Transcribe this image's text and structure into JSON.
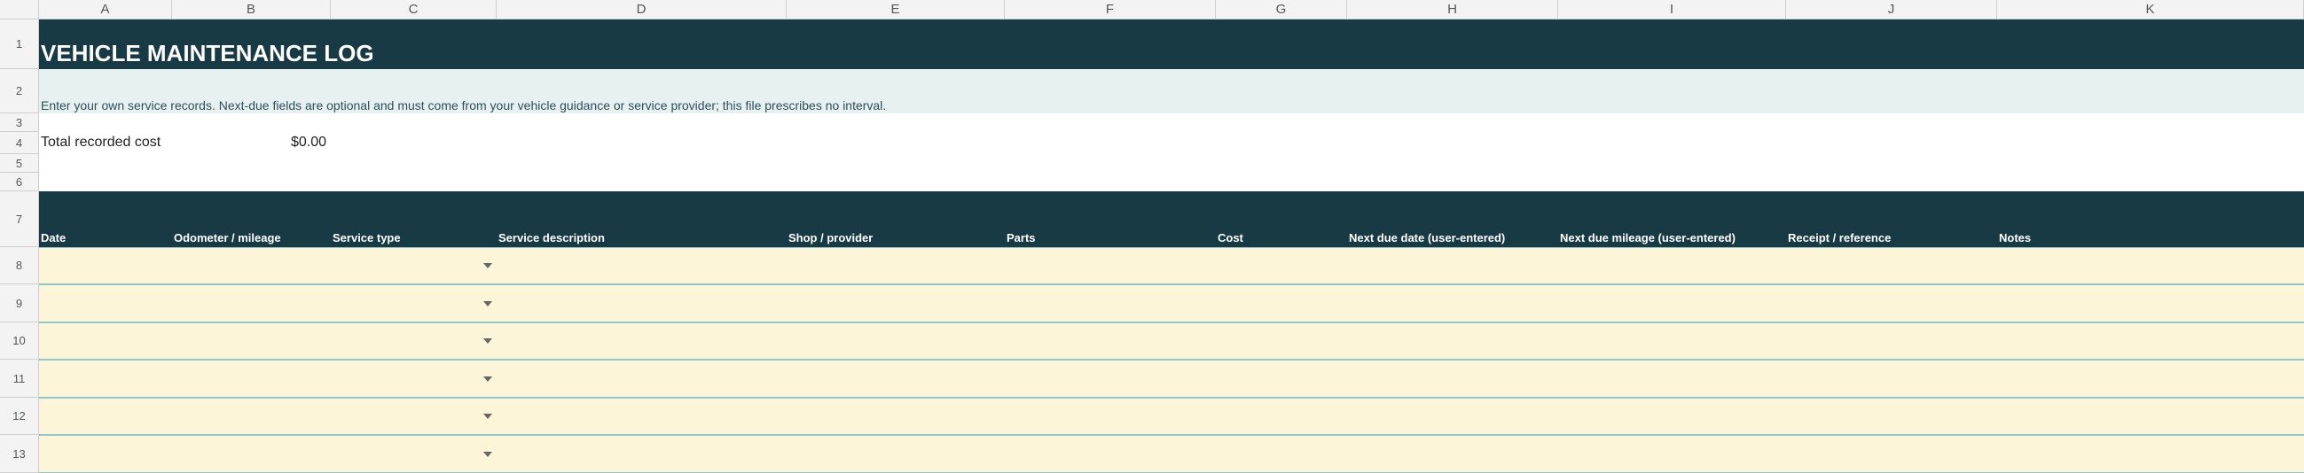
{
  "columns": [
    "A",
    "B",
    "C",
    "D",
    "E",
    "F",
    "G",
    "H",
    "I",
    "J",
    "K"
  ],
  "rows": [
    "1",
    "2",
    "3",
    "4",
    "5",
    "6",
    "7",
    "8",
    "9",
    "10",
    "11",
    "12",
    "13"
  ],
  "title": "VEHICLE MAINTENANCE LOG",
  "note": "Enter your own service records. Next-due fields are optional and must come from your vehicle guidance or service provider; this file prescribes no interval.",
  "summary": {
    "label": "Total recorded cost",
    "value": "$0.00"
  },
  "headers": [
    "Date",
    "Odometer / mileage",
    "Service type",
    "Service description",
    "Shop / provider",
    "Parts",
    "Cost",
    "Next due date (user-entered)",
    "Next due mileage (user-entered)",
    "Receipt / reference",
    "Notes"
  ],
  "colors": {
    "header_bg": "#173a44",
    "note_bg": "#e8f1f2",
    "input_bg": "#fdf5d8",
    "input_border": "#8fc6cf"
  }
}
